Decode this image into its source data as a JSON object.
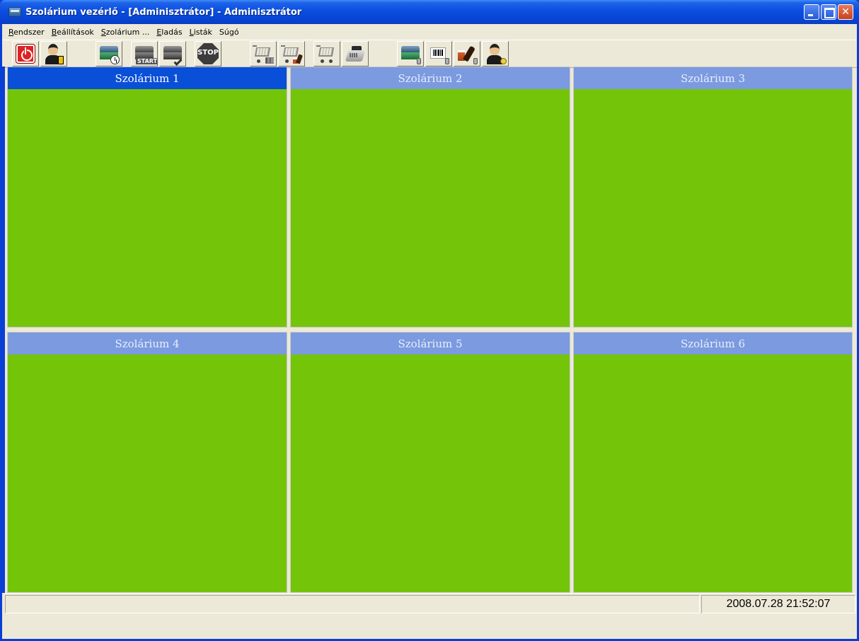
{
  "window": {
    "title": "Szolárium vezérlő  - [Adminisztrátor] - Adminisztrátor"
  },
  "menu": [
    {
      "label": "Rendszer",
      "access": "R"
    },
    {
      "label": "Beállítások",
      "access": "B"
    },
    {
      "label": "Szolárium ...",
      "access": "S"
    },
    {
      "label": "Eladás",
      "access": "E"
    },
    {
      "label": "Listák",
      "access": "L"
    },
    {
      "label": "Súgó",
      "access": ""
    }
  ],
  "toolbar": {
    "icons": [
      "power-icon",
      "user-login-icon",
      "solarium-timer-icon",
      "solarium-start-icon",
      "solarium-check-icon",
      "stop-icon",
      "cart-barcode-icon",
      "cart-products-icon",
      "cart-icon",
      "cash-register-icon",
      "solarium-settings-icon",
      "barcode-settings-icon",
      "products-settings-icon",
      "user-settings-icon"
    ],
    "start_label": "START",
    "stop_label": "STOP"
  },
  "panels": [
    {
      "title": "Szolárium 1",
      "active": true
    },
    {
      "title": "Szolárium 2",
      "active": false
    },
    {
      "title": "Szolárium 3",
      "active": false
    },
    {
      "title": "Szolárium 4",
      "active": false
    },
    {
      "title": "Szolárium 5",
      "active": false
    },
    {
      "title": "Szolárium 6",
      "active": false
    }
  ],
  "colors": {
    "panel_body": "#74c50a",
    "header_active": "#0a4fd8",
    "header_inactive": "#7b9ae0"
  },
  "status": {
    "left": "",
    "datetime": "2008.07.28  21:52:07"
  }
}
